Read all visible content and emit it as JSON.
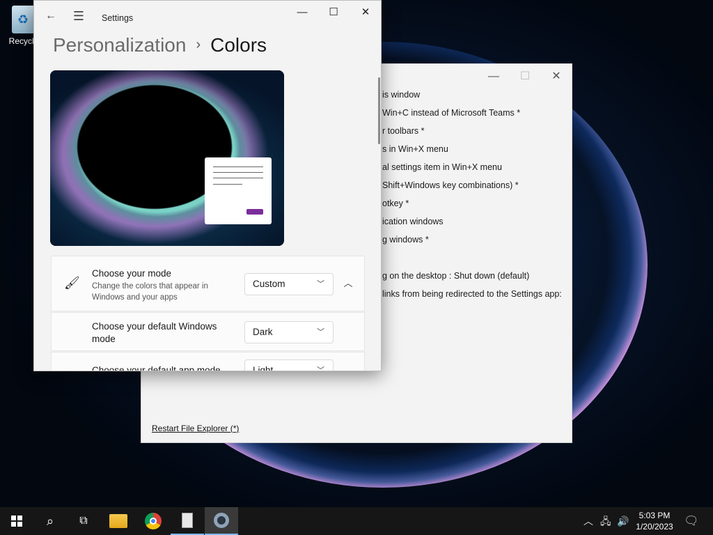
{
  "desktop": {
    "recycle_bin_label": "Recycle"
  },
  "back_window": {
    "options": [
      "is window",
      "Win+C instead of Microsoft Teams *",
      "r toolbars *",
      "s in Win+X menu",
      "al settings item in Win+X menu",
      "Shift+Windows key combinations) *",
      "otkey *",
      "ication windows",
      "g windows *",
      "",
      "g on the desktop : Shut down (default)",
      "links from being redirected to the Settings app:"
    ],
    "restart_link": "Restart File Explorer (*)",
    "minimize": "—",
    "maximize": "☐",
    "close": "✕"
  },
  "settings": {
    "app_title": "Settings",
    "breadcrumb_parent": "Personalization",
    "breadcrumb_separator": "›",
    "breadcrumb_current": "Colors",
    "minimize": "—",
    "maximize": "☐",
    "close": "✕",
    "mode": {
      "title": "Choose your mode",
      "description": "Change the colors that appear in Windows and your apps",
      "value": "Custom"
    },
    "windows_mode": {
      "title": "Choose your default Windows mode",
      "value": "Dark"
    },
    "app_mode": {
      "title": "Choose your default app mode",
      "value": "Light"
    },
    "accent_color": "#7a2e9b"
  },
  "taskbar": {
    "items": [
      "start-icon",
      "search-icon",
      "task-view-icon",
      "file-explorer-icon",
      "chrome-icon",
      "tweaker-app-icon",
      "settings-icon"
    ],
    "time": "5:03 PM",
    "date": "1/20/2023"
  }
}
